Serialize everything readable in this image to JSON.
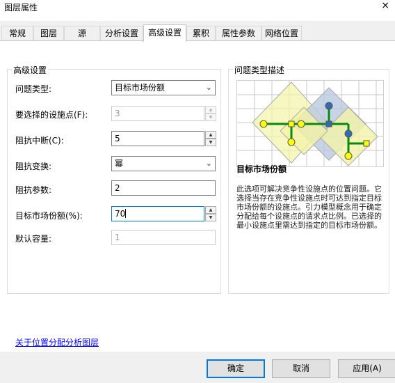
{
  "window": {
    "title": "图层属性",
    "close": "×"
  },
  "tabs": [
    {
      "label": "常规"
    },
    {
      "label": "图层"
    },
    {
      "label": "源"
    },
    {
      "label": "分析设置"
    },
    {
      "label": "高级设置"
    },
    {
      "label": "累积"
    },
    {
      "label": "属性参数"
    },
    {
      "label": "网络位置"
    }
  ],
  "advanced": {
    "group_title": "高级设置",
    "problem_type": {
      "label": "问题类型:",
      "value": "目标市场份额"
    },
    "facilities_to_choose": {
      "label": "要选择的设施点(F):",
      "value": "3"
    },
    "impedance_cutoff": {
      "label": "阻抗中断(C):",
      "value": "5"
    },
    "impedance_transform": {
      "label": "阻抗变换:",
      "value": "幂"
    },
    "impedance_parameter": {
      "label": "阻抗参数:",
      "value": "2"
    },
    "target_market_share": {
      "label": "目标市场份额(%):",
      "value": "70"
    },
    "default_capacity": {
      "label": "默认容量:",
      "value": "1"
    }
  },
  "description": {
    "group_title": "问题类型描述",
    "caption": "目标市场份额",
    "text": "此选项可解决竞争性设施点的位置问题。它选择当存在竞争性设施点时可达到指定目标市场份额的设施点。引力模型概念用于确定分配给每个设施点的请求点比例。已选择的最小设施点里需达到指定的目标市场份额。"
  },
  "link": "关于位置分配分析图层",
  "buttons": {
    "ok": "确定",
    "cancel": "取消",
    "apply": "应用(A)"
  },
  "colors": {
    "accent": "#0078d7",
    "link": "#0000ee"
  }
}
